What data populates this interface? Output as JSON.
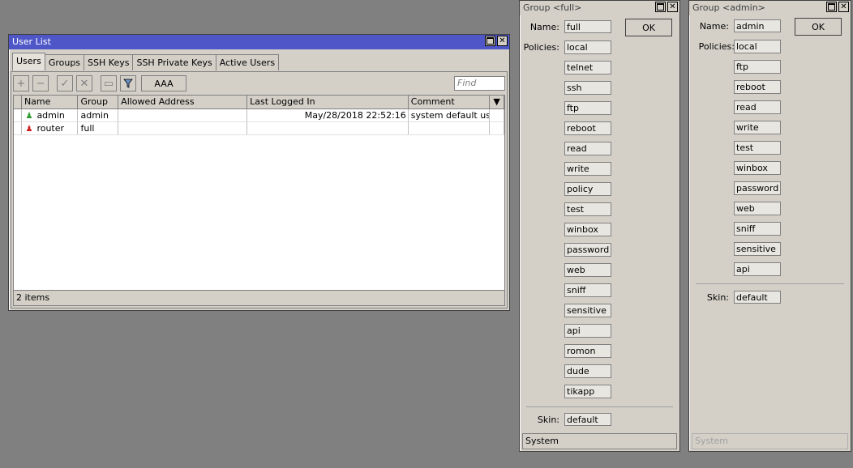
{
  "user_list": {
    "title": "User List",
    "tabs": [
      "Users",
      "Groups",
      "SSH Keys",
      "SSH Private Keys",
      "Active Users"
    ],
    "toolbar": {
      "add": "+",
      "remove": "−",
      "enable": "✓",
      "disable": "✕",
      "comment": "▭",
      "filter_icon": "funnel-icon",
      "aaa": "AAA"
    },
    "find_placeholder": "Find",
    "columns": [
      "Name",
      "Group",
      "Allowed Address",
      "Last Logged In",
      "Comment"
    ],
    "rows": [
      {
        "name": "admin",
        "group": "admin",
        "allowed_address": "",
        "last_logged_in": "May/28/2018 22:52:16",
        "comment": "system default user",
        "icon_color": "#2e9a2e"
      },
      {
        "name": "router",
        "group": "full",
        "allowed_address": "",
        "last_logged_in": "",
        "comment": "",
        "icon_color": "#cc2222"
      }
    ],
    "status": "2 items"
  },
  "group_full": {
    "title": "Group <full>",
    "name_label": "Name:",
    "name": "full",
    "policies_label": "Policies:",
    "policies": [
      "local",
      "telnet",
      "ssh",
      "ftp",
      "reboot",
      "read",
      "write",
      "policy",
      "test",
      "winbox",
      "password",
      "web",
      "sniff",
      "sensitive",
      "api",
      "romon",
      "dude",
      "tikapp"
    ],
    "skin_label": "Skin:",
    "skin": "default",
    "ok": "OK",
    "status": "System"
  },
  "group_admin": {
    "title": "Group <admin>",
    "name_label": "Name:",
    "name": "admin",
    "policies_label": "Policies:",
    "policies": [
      "local",
      "ftp",
      "reboot",
      "read",
      "write",
      "test",
      "winbox",
      "password",
      "web",
      "sniff",
      "sensitive",
      "api"
    ],
    "skin_label": "Skin:",
    "skin": "default",
    "ok": "OK",
    "status": "System"
  }
}
